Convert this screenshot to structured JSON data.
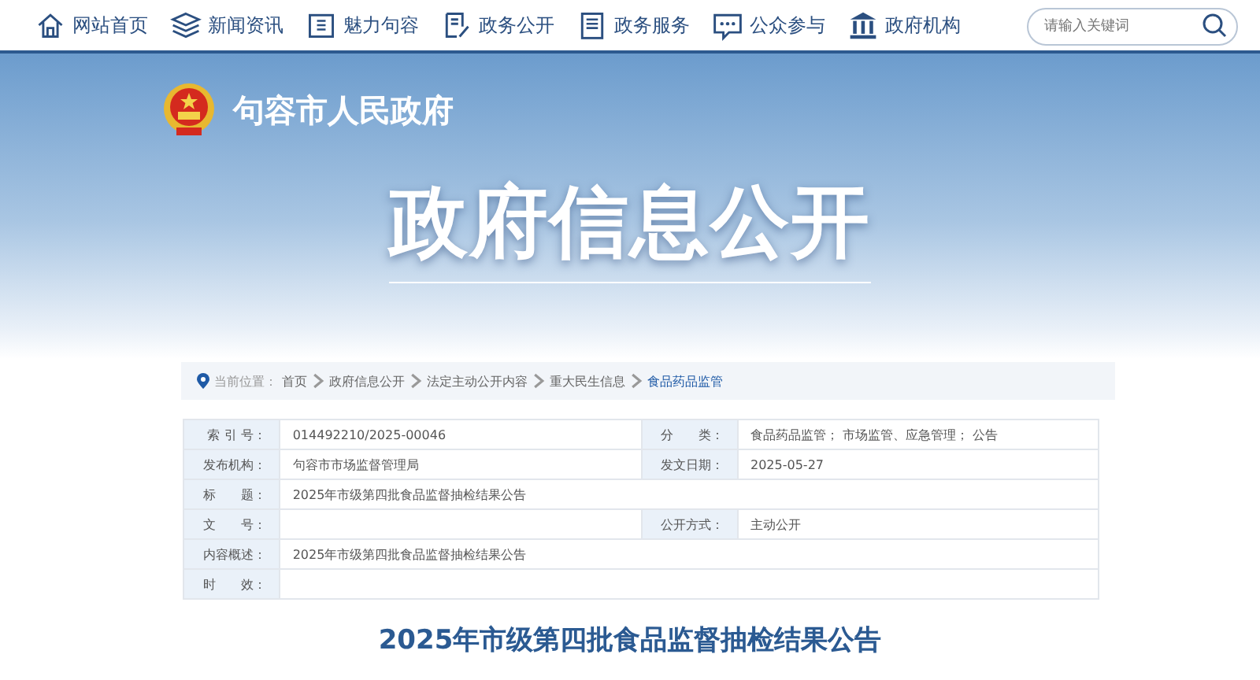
{
  "nav": {
    "items": [
      {
        "label": "网站首页"
      },
      {
        "label": "新闻资讯"
      },
      {
        "label": "魅力句容"
      },
      {
        "label": "政务公开"
      },
      {
        "label": "政务服务"
      },
      {
        "label": "公众参与"
      },
      {
        "label": "政府机构"
      }
    ],
    "search": {
      "placeholder": "请输入关键词"
    }
  },
  "banner": {
    "site_name": "句容市人民政府",
    "title": "政府信息公开"
  },
  "breadcrumb": {
    "label": "当前位置：",
    "items": [
      {
        "label": "首页",
        "selected": false
      },
      {
        "label": "政府信息公开",
        "selected": false
      },
      {
        "label": "法定主动公开内容",
        "selected": false
      },
      {
        "label": "重大民生信息",
        "selected": false
      },
      {
        "label": "食品药品监管",
        "selected": true
      }
    ]
  },
  "info_table": {
    "rows": [
      [
        {
          "label": "索 引 号：",
          "value": "014492210/2025-00046"
        },
        {
          "label": "分　　类：",
          "value": "食品药品监管； 市场监管、应急管理； 公告"
        }
      ],
      [
        {
          "label": "发布机构：",
          "value": "句容市市场监督管理局"
        },
        {
          "label": "发文日期：",
          "value": "2025-05-27"
        }
      ],
      [
        {
          "label": "标　　题：",
          "value": "2025年市级第四批食品监督抽检结果公告"
        }
      ],
      [
        {
          "label": "文　　号："
        },
        {
          "label": "公开方式：",
          "value": "主动公开"
        }
      ],
      [
        {
          "label": "内容概述：",
          "value": "2025年市级第四批食品监督抽检结果公告"
        }
      ],
      [
        {
          "label": "时　　效："
        }
      ]
    ]
  },
  "article": {
    "title": "2025年市级第四批食品监督抽检结果公告"
  }
}
